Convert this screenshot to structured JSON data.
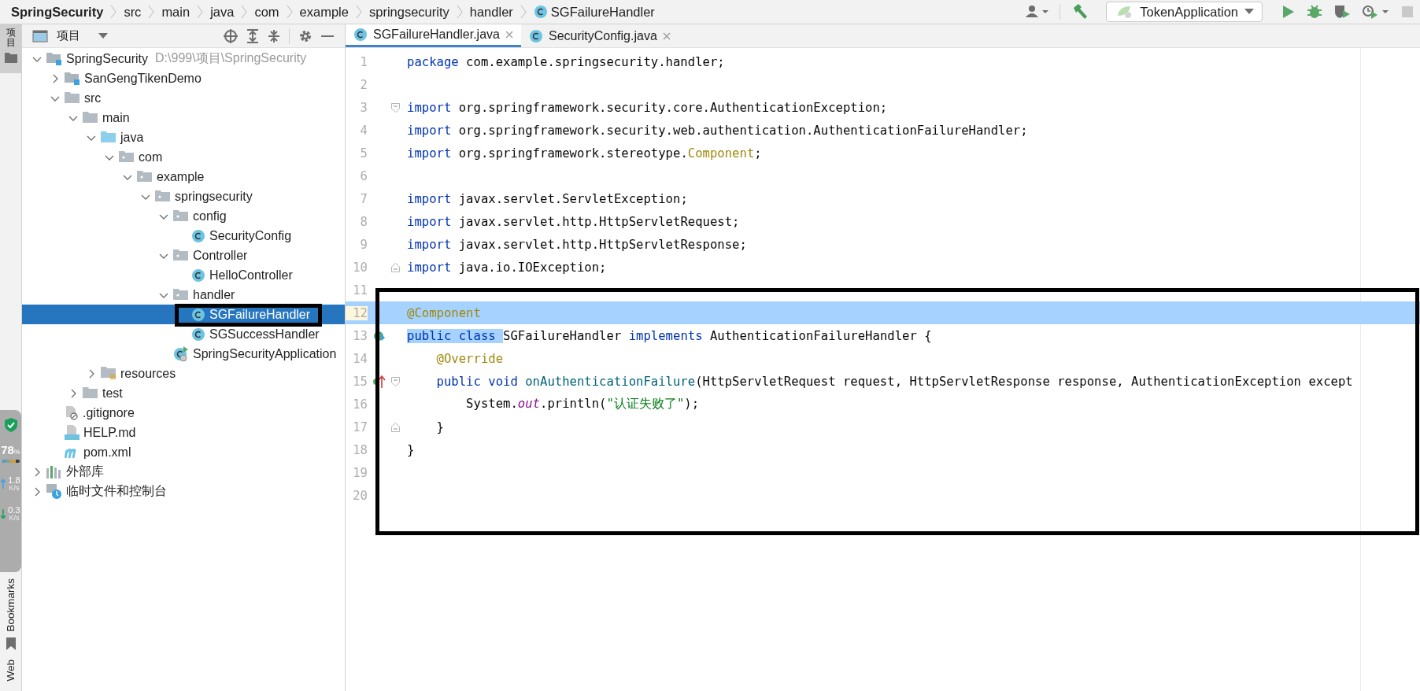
{
  "breadcrumb": [
    "SpringSecurity",
    "src",
    "main",
    "java",
    "com",
    "example",
    "springsecurity",
    "handler",
    "SGFailureHandler"
  ],
  "run_config": {
    "label": "TokenApplication"
  },
  "side_strip": {
    "top_tab": {
      "label": "项目",
      "selected": true
    },
    "bottom_tabs": [
      {
        "label": "Bookmarks",
        "selected": false
      },
      {
        "label": "Web",
        "selected": false
      }
    ]
  },
  "project_panel": {
    "title": "项目"
  },
  "tree": [
    {
      "label": "SpringSecurity",
      "hint": "D:\\999\\项目\\SpringSecurity",
      "kind": "module",
      "expanded": true,
      "selected": false,
      "children": [
        {
          "label": "SanGengTikenDemo",
          "kind": "module",
          "expanded": false,
          "selected": false
        },
        {
          "label": "src",
          "kind": "folder",
          "expanded": true,
          "selected": false,
          "children": [
            {
              "label": "main",
              "kind": "folder",
              "expanded": true,
              "selected": false,
              "children": [
                {
                  "label": "java",
                  "kind": "source",
                  "expanded": true,
                  "selected": false,
                  "children": [
                    {
                      "label": "com",
                      "kind": "package",
                      "expanded": true,
                      "selected": false,
                      "children": [
                        {
                          "label": "example",
                          "kind": "package",
                          "expanded": true,
                          "selected": false,
                          "children": [
                            {
                              "label": "springsecurity",
                              "kind": "package",
                              "expanded": true,
                              "selected": false,
                              "children": [
                                {
                                  "label": "config",
                                  "kind": "package",
                                  "expanded": true,
                                  "selected": false,
                                  "children": [
                                    {
                                      "label": "SecurityConfig",
                                      "kind": "class",
                                      "selected": false
                                    }
                                  ]
                                },
                                {
                                  "label": "Controller",
                                  "kind": "package",
                                  "expanded": true,
                                  "selected": false,
                                  "children": [
                                    {
                                      "label": "HelloController",
                                      "kind": "class",
                                      "selected": false
                                    }
                                  ]
                                },
                                {
                                  "label": "handler",
                                  "kind": "package",
                                  "expanded": true,
                                  "selected": false,
                                  "children": [
                                    {
                                      "label": "SGFailureHandler",
                                      "kind": "class",
                                      "selected": true
                                    },
                                    {
                                      "label": "SGSuccessHandler",
                                      "kind": "class",
                                      "selected": false
                                    }
                                  ]
                                },
                                {
                                  "label": "SpringSecurityApplication",
                                  "kind": "app",
                                  "selected": false
                                }
                              ]
                            }
                          ]
                        }
                      ]
                    }
                  ]
                },
                {
                  "label": "resources",
                  "kind": "resources",
                  "expanded": false,
                  "selected": false
                }
              ]
            },
            {
              "label": "test",
              "kind": "folder",
              "expanded": false,
              "selected": false
            }
          ]
        },
        {
          "label": ".gitignore",
          "kind": "ignore",
          "selected": false
        },
        {
          "label": "HELP.md",
          "kind": "md",
          "selected": false
        },
        {
          "label": "pom.xml",
          "kind": "maven",
          "selected": false
        }
      ]
    },
    {
      "label": "外部库",
      "kind": "libraries",
      "expanded": false,
      "selected": false
    },
    {
      "label": "临时文件和控制台",
      "kind": "scratches",
      "expanded": false,
      "selected": false
    }
  ],
  "tabs": [
    {
      "label": "SGFailureHandler.java",
      "selected": true
    },
    {
      "label": "SecurityConfig.java",
      "selected": false
    }
  ],
  "code": [
    {
      "n": "1",
      "segs": [
        {
          "kind": "kw",
          "text": "package"
        },
        {
          "kind": "plain",
          "text": " com.example.springsecurity.handler;"
        }
      ]
    },
    {
      "n": "2"
    },
    {
      "n": "3",
      "fold_start": true,
      "segs": [
        {
          "kind": "kw",
          "text": "import"
        },
        {
          "kind": "plain",
          "text": " org.springframework.security.core.AuthenticationException;"
        }
      ]
    },
    {
      "n": "4",
      "segs": [
        {
          "kind": "kw",
          "text": "import"
        },
        {
          "kind": "plain",
          "text": " org.springframework.security.web.authentication.AuthenticationFailureHandler;"
        }
      ]
    },
    {
      "n": "5",
      "segs": [
        {
          "kind": "kw",
          "text": "import"
        },
        {
          "kind": "plain",
          "text": " org.springframework.stereotype."
        },
        {
          "kind": "ann",
          "text": "Component"
        },
        {
          "kind": "plain",
          "text": ";"
        }
      ]
    },
    {
      "n": "6"
    },
    {
      "n": "7",
      "segs": [
        {
          "kind": "kw",
          "text": "import"
        },
        {
          "kind": "plain",
          "text": " javax.servlet.ServletException;"
        }
      ]
    },
    {
      "n": "8",
      "segs": [
        {
          "kind": "kw",
          "text": "import"
        },
        {
          "kind": "plain",
          "text": " javax.servlet.http.HttpServletRequest;"
        }
      ]
    },
    {
      "n": "9",
      "segs": [
        {
          "kind": "kw",
          "text": "import"
        },
        {
          "kind": "plain",
          "text": " javax.servlet.http.HttpServletResponse;"
        }
      ]
    },
    {
      "n": "10",
      "fold_end": true,
      "segs": [
        {
          "kind": "kw",
          "text": "import"
        },
        {
          "kind": "plain",
          "text": " java.io.IOException;"
        }
      ]
    },
    {
      "n": "11"
    },
    {
      "n": "12",
      "selected": true,
      "segs": [
        {
          "kind": "ann",
          "text": "@Component"
        }
      ]
    },
    {
      "n": "13",
      "bean_marker": true,
      "segs": [
        {
          "kind": "kw",
          "text": "public class ",
          "selected": true
        },
        {
          "kind": "plain",
          "text": "SGFailureHandler ",
          "selected": false
        },
        {
          "kind": "kw",
          "text": "implements ",
          "selected": false
        },
        {
          "kind": "plain",
          "text": "AuthenticationFailureHandler {",
          "selected": false
        }
      ]
    },
    {
      "n": "14",
      "segs": [
        {
          "kind": "ann",
          "text": "    @Override"
        }
      ]
    },
    {
      "n": "15",
      "override_marker": true,
      "fold_start": true,
      "segs": [
        {
          "kind": "kw",
          "text": "    public void "
        },
        {
          "kind": "method",
          "text": "onAuthenticationFailure"
        },
        {
          "kind": "plain",
          "text": "(HttpServletRequest request, HttpServletResponse response, AuthenticationException except"
        }
      ]
    },
    {
      "n": "16",
      "segs": [
        {
          "kind": "plain",
          "text": "        System."
        },
        {
          "kind": "field",
          "text": "out"
        },
        {
          "kind": "plain",
          "text": ".println("
        },
        {
          "kind": "str",
          "text": "\"认证失败了\""
        },
        {
          "kind": "plain",
          "text": ");"
        }
      ]
    },
    {
      "n": "17",
      "fold_end": true,
      "segs": [
        {
          "kind": "plain",
          "text": "    }"
        }
      ]
    },
    {
      "n": "18",
      "segs": [
        {
          "kind": "plain",
          "text": "}"
        }
      ]
    },
    {
      "n": "19"
    },
    {
      "n": "20"
    }
  ],
  "monitor": {
    "percent": "78",
    "unit": "%",
    "level": 0.78,
    "upload": {
      "value": "1.8",
      "unit": "K/s"
    },
    "download": {
      "value": "0.3",
      "unit": "K/s"
    }
  }
}
